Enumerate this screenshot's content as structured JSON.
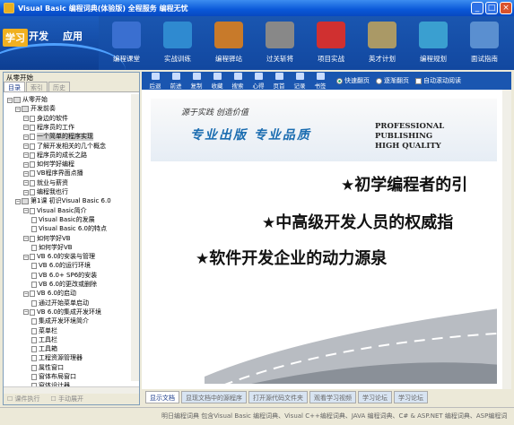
{
  "window": {
    "title": "Visual Basic 编程词典(体验版)  全程服务  编程无忧",
    "buttons": [
      "_",
      "□",
      "×"
    ]
  },
  "brand": {
    "part1": "学习",
    "part2": "开发",
    "part3": "应用"
  },
  "nav": [
    {
      "label": "编程课堂",
      "icon": "blackboard-icon"
    },
    {
      "label": "实战训练",
      "icon": "monitor-icon"
    },
    {
      "label": "编程驿站",
      "icon": "house-icon"
    },
    {
      "label": "过关斩将",
      "icon": "castle-icon"
    },
    {
      "label": "项目实战",
      "icon": "target-icon"
    },
    {
      "label": "英才计划",
      "icon": "people-icon"
    },
    {
      "label": "编程规划",
      "icon": "pencil-icon"
    },
    {
      "label": "面试指南",
      "icon": "signpost-icon"
    }
  ],
  "toolbar": {
    "buttons": [
      "后退",
      "前进",
      "复制",
      "收藏",
      "搜索",
      "心得",
      "页首",
      "记录",
      "书签"
    ],
    "options": [
      "快速翻页",
      "逐渐翻页",
      "自动滚动阅读"
    ]
  },
  "left": {
    "title": "从零开始",
    "tabs": [
      "目录",
      "索引",
      "历史"
    ],
    "tree": [
      {
        "text": "从零开始",
        "depth": 0
      },
      {
        "text": "开发前奏",
        "depth": 1
      },
      {
        "text": "身边的软件",
        "depth": 2
      },
      {
        "text": "程序员的工作",
        "depth": 2
      },
      {
        "text": "一个简单的程序实现",
        "depth": 2,
        "sel": true
      },
      {
        "text": "了解开发相关的几个概念",
        "depth": 2
      },
      {
        "text": "程序员的成长之路",
        "depth": 2
      },
      {
        "text": "如何学好编程",
        "depth": 2
      },
      {
        "text": "VB程序界面点播",
        "depth": 2
      },
      {
        "text": "就业与薪资",
        "depth": 2
      },
      {
        "text": "编程我也行",
        "depth": 2
      },
      {
        "text": "第1课  初识Visual Basic 6.0",
        "depth": 1
      },
      {
        "text": "Visual Basic简介",
        "depth": 2
      },
      {
        "text": "Visual Basic的发展",
        "depth": 3
      },
      {
        "text": "Visual Basic 6.0的特点",
        "depth": 3
      },
      {
        "text": "如何学好VB",
        "depth": 2
      },
      {
        "text": "如何学好VB",
        "depth": 3
      },
      {
        "text": "VB 6.0的安装与管理",
        "depth": 2
      },
      {
        "text": "VB 6.0的运行环境",
        "depth": 3
      },
      {
        "text": "VB 6.0+ SP6的安装",
        "depth": 3
      },
      {
        "text": "VB 6.0的更改或删除",
        "depth": 3
      },
      {
        "text": "VB 6.0的启动",
        "depth": 2
      },
      {
        "text": "通过开始菜单启动",
        "depth": 3
      },
      {
        "text": "VB 6.0的集成开发环境",
        "depth": 2
      },
      {
        "text": "集成开发环境简介",
        "depth": 3
      },
      {
        "text": "菜单栏",
        "depth": 3
      },
      {
        "text": "工具栏",
        "depth": 3
      },
      {
        "text": "工具箱",
        "depth": 3
      },
      {
        "text": "工程资源管理器",
        "depth": 3
      },
      {
        "text": "属性窗口",
        "depth": 3
      },
      {
        "text": "窗体布局窗口",
        "depth": 3
      },
      {
        "text": "窗体设计器",
        "depth": 3
      }
    ],
    "footer": [
      "课件执行",
      "手动展开"
    ]
  },
  "doc": {
    "slogan": "源于实践   创造价值",
    "pro1": "PROFESSIONAL PUBLISHING",
    "pro2": "HIGH QUALITY",
    "motto": "专业出版  专业品质",
    "line1": "初学编程者的引",
    "line2": "中高级开发人员的权威指",
    "line3": "软件开发企业的动力源泉"
  },
  "bottom_tabs": [
    "显示文档",
    "显现文档中的源程序",
    "打开源代码文件夹",
    "观看学习视频",
    "学习论坛",
    "学习论坛"
  ],
  "status": "明日编程词典 包含Visual Basic 编程词典、Visual C++编程词典、JAVA 编程词典、C# & ASP.NET 编程词典、ASP编程词",
  "colors": {
    "accent": "#1a56b0",
    "title": "#0a58d8"
  }
}
